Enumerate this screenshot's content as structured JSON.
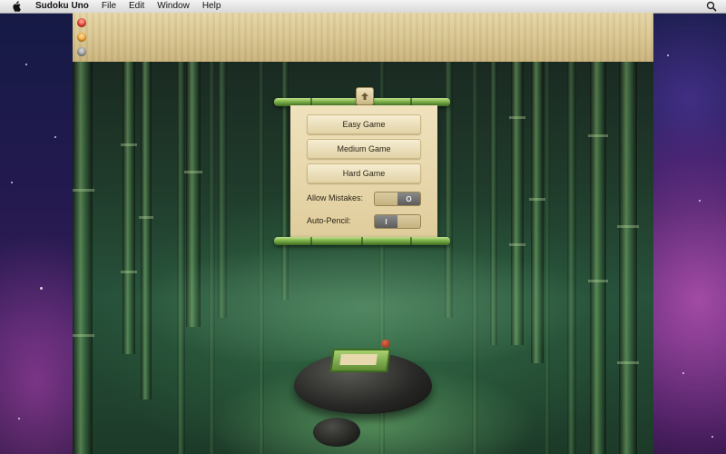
{
  "menubar": {
    "app_name": "Sudoku Uno",
    "items": [
      "File",
      "Edit",
      "Window",
      "Help"
    ],
    "apple_icon": "apple-icon",
    "search_icon": "spotlight-search-icon"
  },
  "window": {
    "controls": [
      "close",
      "minimize",
      "zoom"
    ]
  },
  "menu": {
    "buttons": {
      "easy": "Easy Game",
      "medium": "Medium Game",
      "hard": "Hard Game"
    },
    "options": {
      "allow_mistakes_label": "Allow Mistakes:",
      "auto_pencil_label": "Auto-Pencil:",
      "allow_mistakes_state": "O",
      "auto_pencil_state": "I"
    },
    "collapse_icon": "up-arrow-icon"
  },
  "colors": {
    "parchment": "#e8d8ad",
    "bamboo": "#7cb04a",
    "titlebar": "#d7c48f"
  }
}
